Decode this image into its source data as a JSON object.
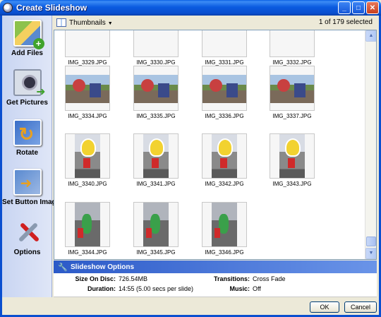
{
  "window": {
    "title": "Create Slideshow"
  },
  "sidebar": {
    "items": [
      {
        "label": "Add Files",
        "icon": "add-files-icon"
      },
      {
        "label": "Get Pictures",
        "icon": "camera-icon"
      },
      {
        "label": "Rotate",
        "icon": "rotate-icon"
      },
      {
        "label": "Set Button Image",
        "icon": "set-button-image-icon"
      },
      {
        "label": "Options",
        "icon": "tools-icon"
      }
    ]
  },
  "toolbar": {
    "view_label": "Thumbnails",
    "selected_text": "1 of 179 selected"
  },
  "thumbnails": [
    {
      "name": "IMG_3329.JPG",
      "kind": "partial"
    },
    {
      "name": "IMG_3330.JPG",
      "kind": "partial"
    },
    {
      "name": "IMG_3331.JPG",
      "kind": "partial"
    },
    {
      "name": "IMG_3332.JPG",
      "kind": "partial"
    },
    {
      "name": "IMG_3334.JPG",
      "kind": "land"
    },
    {
      "name": "IMG_3335.JPG",
      "kind": "land"
    },
    {
      "name": "IMG_3336.JPG",
      "kind": "land"
    },
    {
      "name": "IMG_3337.JPG",
      "kind": "land"
    },
    {
      "name": "IMG_3340.JPG",
      "kind": "port"
    },
    {
      "name": "IMG_3341.JPG",
      "kind": "port"
    },
    {
      "name": "IMG_3342.JPG",
      "kind": "port"
    },
    {
      "name": "IMG_3343.JPG",
      "kind": "port"
    },
    {
      "name": "IMG_3344.JPG",
      "kind": "green"
    },
    {
      "name": "IMG_3345.JPG",
      "kind": "green"
    },
    {
      "name": "IMG_3346.JPG",
      "kind": "green"
    }
  ],
  "options": {
    "header": "Slideshow Options",
    "size_on_disc_label": "Size On Disc:",
    "size_on_disc_value": "726.54MB",
    "duration_label": "Duration:",
    "duration_value": "14:55 (5.00 secs per slide)",
    "transitions_label": "Transitions:",
    "transitions_value": "Cross Fade",
    "music_label": "Music:",
    "music_value": "Off"
  },
  "footer": {
    "ok_label": "OK",
    "cancel_label": "Cancel"
  }
}
